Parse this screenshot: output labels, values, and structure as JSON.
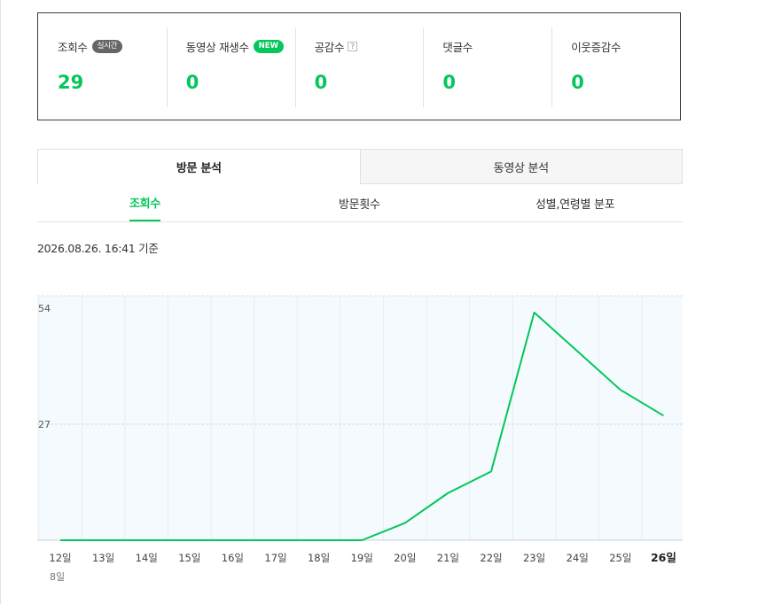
{
  "stats": [
    {
      "label": "조회수",
      "badge": "실시간",
      "value": "29"
    },
    {
      "label": "동영상 재생수",
      "badge": "NEW",
      "value": "0"
    },
    {
      "label": "공감수",
      "help": "?",
      "value": "0"
    },
    {
      "label": "댓글수",
      "value": "0"
    },
    {
      "label": "이웃증감수",
      "value": "0"
    }
  ],
  "main_tabs": [
    {
      "label": "방문 분석",
      "active": true
    },
    {
      "label": "동영상 분석",
      "active": false
    }
  ],
  "sub_tabs": [
    {
      "label": "조회수",
      "active": true
    },
    {
      "label": "방문횟수",
      "active": false
    },
    {
      "label": "성별,연령별 분포",
      "active": false
    }
  ],
  "timestamp": "2026.08.26. 16:41 기준",
  "colors": {
    "accent": "#03c75a",
    "chart_bg": "#f4fafd"
  },
  "chart_data": {
    "type": "line",
    "title": "",
    "xlabel": "",
    "ylabel": "",
    "x_month_label": "8일",
    "categories": [
      "12일",
      "13일",
      "14일",
      "15일",
      "16일",
      "17일",
      "18일",
      "19일",
      "20일",
      "21일",
      "22일",
      "23일",
      "24일",
      "25일",
      "26일"
    ],
    "series": [
      {
        "values": [
          0,
          0,
          0,
          0,
          0,
          0,
          0,
          0,
          4,
          11,
          16,
          53,
          44,
          35,
          29
        ]
      }
    ],
    "y_ticks": [
      "54",
      "27"
    ],
    "ylim": [
      0,
      54
    ],
    "grid": true,
    "line_color": "#03c75a"
  }
}
